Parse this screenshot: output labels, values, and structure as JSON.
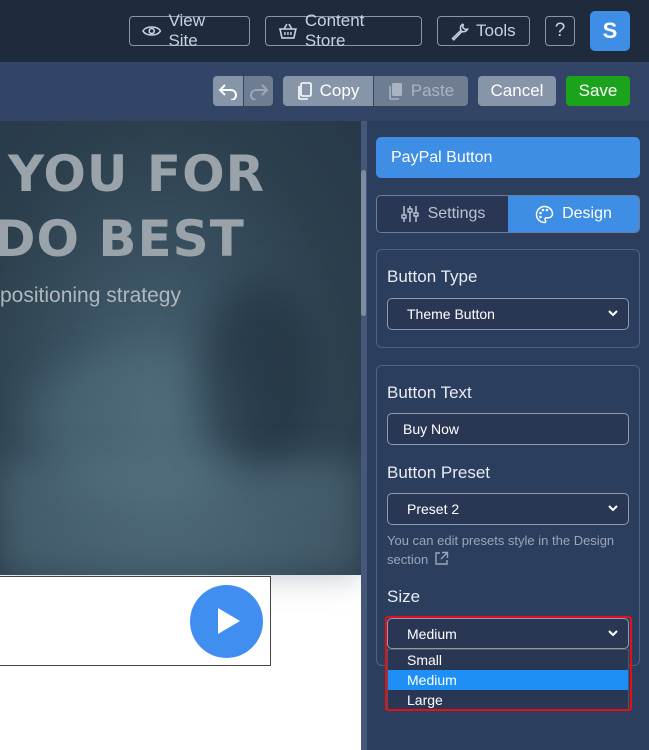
{
  "header": {
    "view_site": "View Site",
    "content_store": "Content Store",
    "tools": "Tools",
    "help": "?",
    "avatar_letter": "S"
  },
  "toolbar": {
    "copy": "Copy",
    "paste": "Paste",
    "cancel": "Cancel",
    "save": "Save"
  },
  "canvas": {
    "heading_line1": "YOU FOR",
    "heading_line2": "DO BEST",
    "subheading": "positioning strategy"
  },
  "panel": {
    "title": "PayPal Button",
    "tabs": [
      {
        "label": "Settings",
        "active": false
      },
      {
        "label": "Design",
        "active": true
      }
    ],
    "button_type": {
      "label": "Button Type",
      "value": "Theme Button"
    },
    "button_text": {
      "label": "Button Text",
      "value": "Buy Now"
    },
    "button_preset": {
      "label": "Button Preset",
      "value": "Preset 2"
    },
    "preset_hint": "You can edit presets style in the Design section",
    "size": {
      "label": "Size",
      "value": "Medium",
      "options": [
        "Small",
        "Medium",
        "Large"
      ],
      "selected_option": "Medium"
    }
  },
  "colors": {
    "accent": "#3d8ee4",
    "save": "#1ba31b",
    "highlight_border": "#e3101a",
    "panel_bg": "#2c3e5e"
  }
}
